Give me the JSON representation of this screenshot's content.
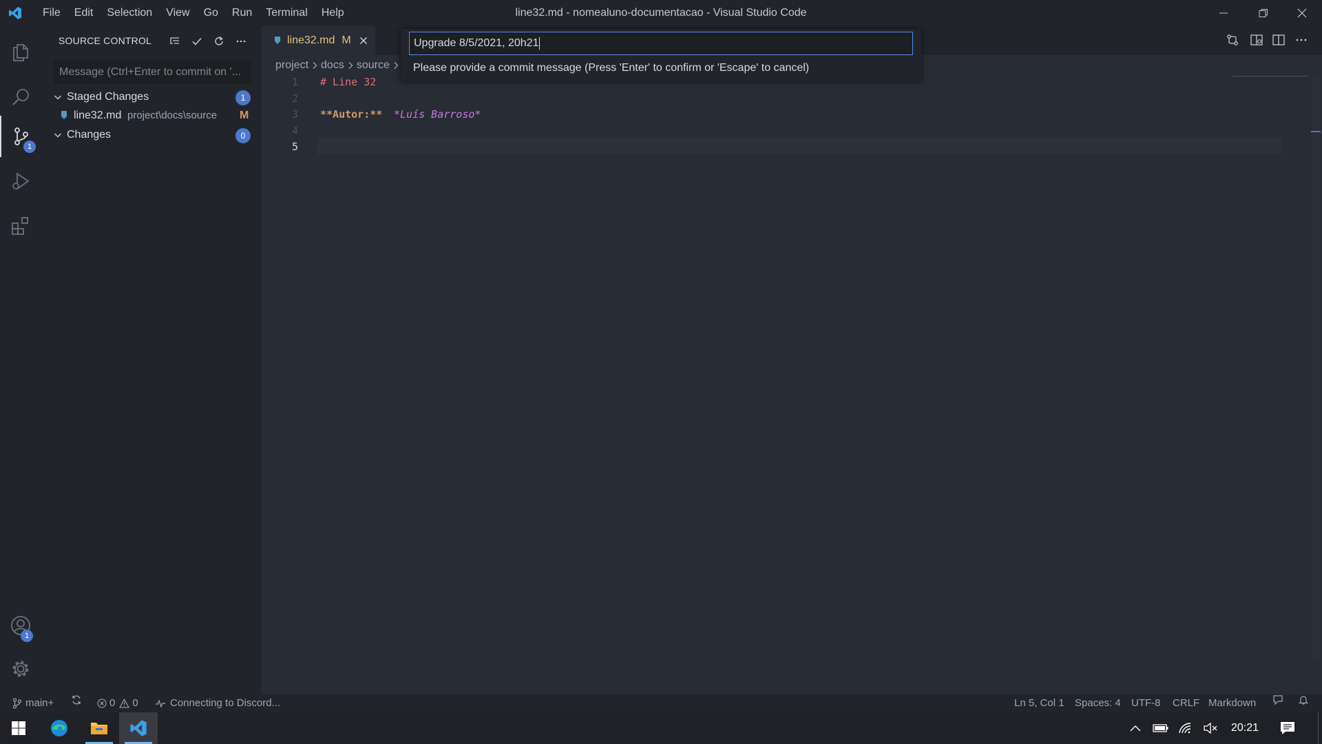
{
  "window": {
    "title": "line32.md - nomealuno-documentacao - Visual Studio Code",
    "menu": [
      "File",
      "Edit",
      "Selection",
      "View",
      "Go",
      "Run",
      "Terminal",
      "Help"
    ]
  },
  "activity_bar": {
    "scm_badge": "1",
    "accounts_badge": "1"
  },
  "sidebar": {
    "title": "SOURCE CONTROL",
    "commit_placeholder": "Message (Ctrl+Enter to commit on '...",
    "staged": {
      "label": "Staged Changes",
      "count": "1"
    },
    "staged_file": {
      "name": "line32.md",
      "path": "project\\docs\\source",
      "status": "M"
    },
    "changes": {
      "label": "Changes",
      "count": "0"
    }
  },
  "editor": {
    "tab": {
      "label": "line32.md",
      "status": "M"
    },
    "breadcrumb": [
      "project",
      "docs",
      "source"
    ],
    "lines": [
      {
        "num": "1",
        "text": "# Line 32"
      },
      {
        "num": "2",
        "text": ""
      },
      {
        "num": "3",
        "bold": "**Autor:**",
        "italic": "*Luís Barroso*"
      },
      {
        "num": "4",
        "text": ""
      },
      {
        "num": "5",
        "text": ""
      }
    ]
  },
  "quick_input": {
    "value": "Upgrade 8/5/2021, 20h21",
    "hint": "Please provide a commit message (Press 'Enter' to confirm or 'Escape' to cancel)"
  },
  "status_bar": {
    "branch": "main+",
    "errors": "0",
    "warnings": "0",
    "discord": "Connecting to Discord...",
    "position": "Ln 5, Col 1",
    "spaces": "Spaces: 4",
    "encoding": "UTF-8",
    "eol": "CRLF",
    "language": "Markdown"
  },
  "taskbar": {
    "time": "20:21"
  },
  "colors": {
    "accent": "#4d78cc",
    "heading": "#e06c75",
    "bold": "#d19a66",
    "italic": "#c678dd",
    "focus_border": "#568af2"
  }
}
